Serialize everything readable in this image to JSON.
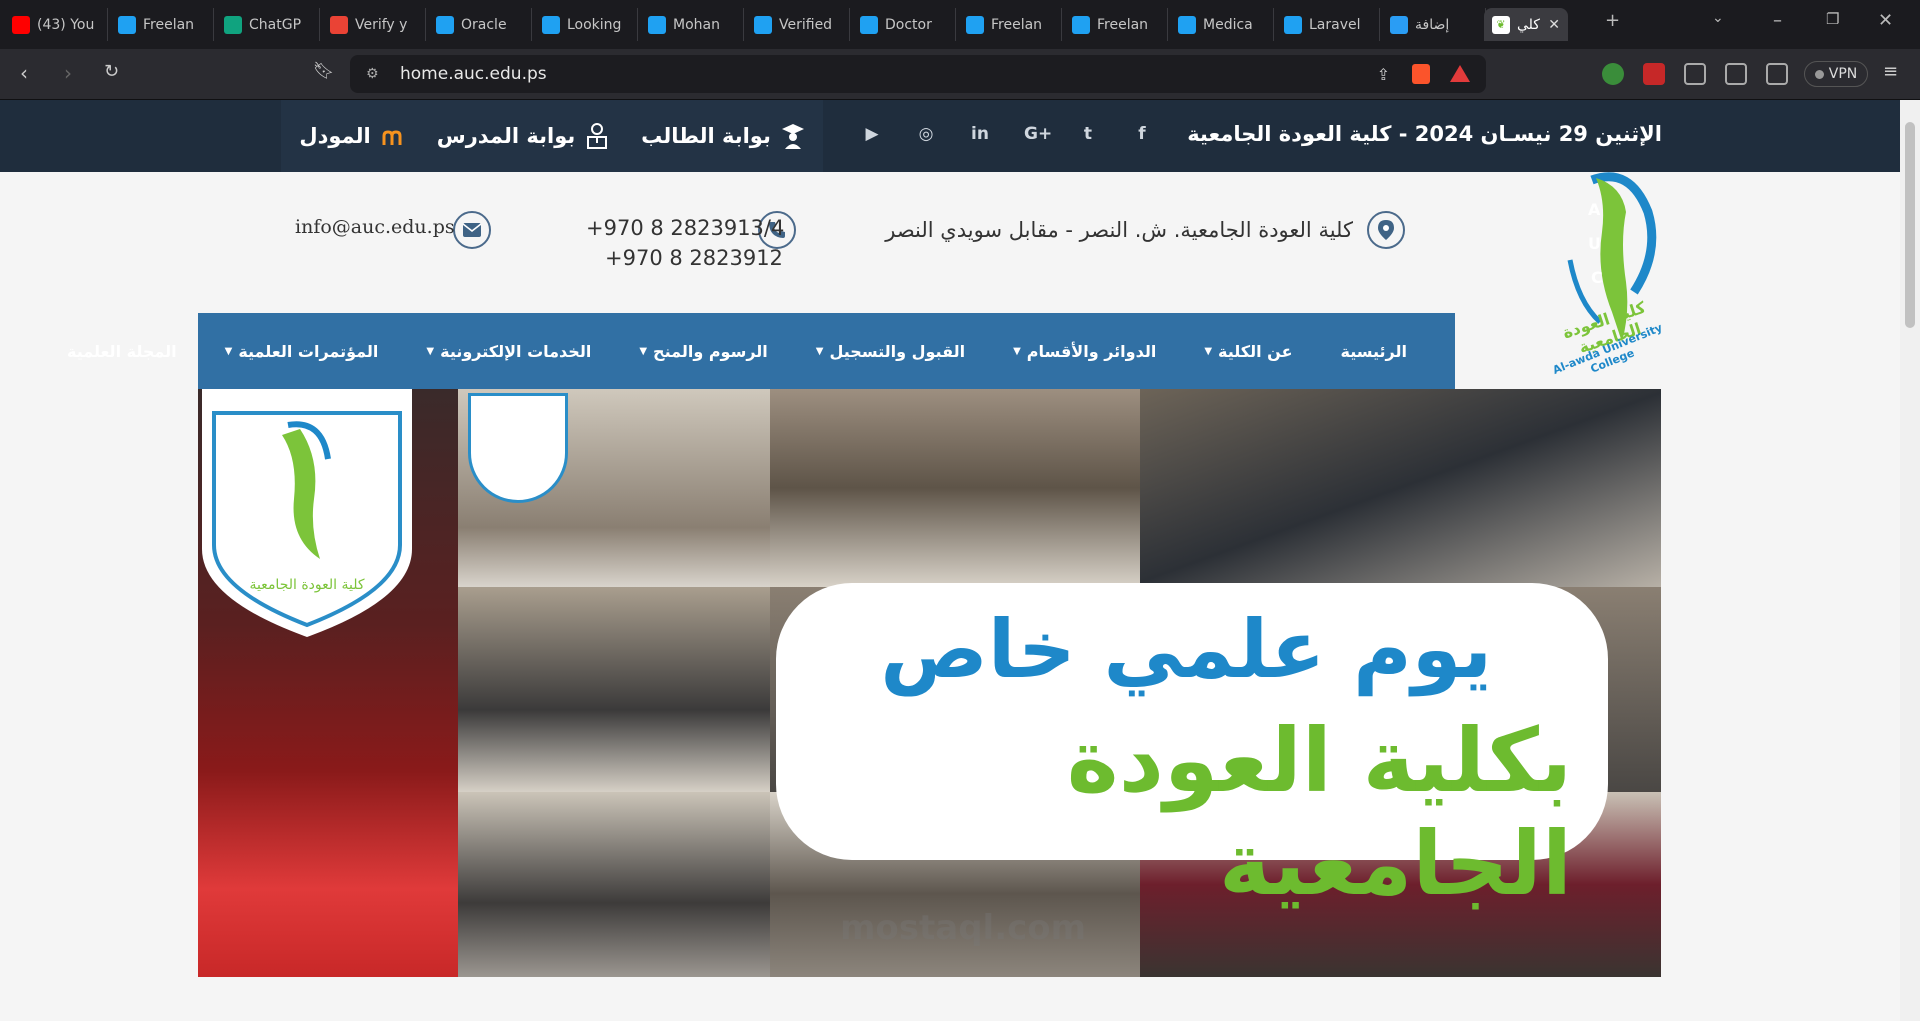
{
  "browser": {
    "tabs": [
      {
        "label": "(43) You",
        "favicon": "youtube-icon",
        "color": "#ff0000"
      },
      {
        "label": "Freelan",
        "favicon": "bird-icon",
        "color": "#1fa1f2"
      },
      {
        "label": "ChatGP",
        "favicon": "chatgpt-icon",
        "color": "#10a37f"
      },
      {
        "label": "Verify y",
        "favicon": "gmail-icon",
        "color": "#ea4335"
      },
      {
        "label": "Oracle",
        "favicon": "bird-icon",
        "color": "#1fa1f2"
      },
      {
        "label": "Looking",
        "favicon": "bird-icon",
        "color": "#1fa1f2"
      },
      {
        "label": "Mohan",
        "favicon": "bird-icon",
        "color": "#1fa1f2"
      },
      {
        "label": "Verified",
        "favicon": "bird-icon",
        "color": "#1fa1f2"
      },
      {
        "label": "Doctor",
        "favicon": "bird-icon",
        "color": "#1fa1f2"
      },
      {
        "label": "Freelan",
        "favicon": "bird-icon",
        "color": "#1fa1f2"
      },
      {
        "label": "Freelan",
        "favicon": "bird-icon",
        "color": "#1fa1f2"
      },
      {
        "label": "Medica",
        "favicon": "bird-icon",
        "color": "#1fa1f2"
      },
      {
        "label": "Laravel",
        "favicon": "bird-icon",
        "color": "#1fa1f2"
      },
      {
        "label": "إضافة",
        "favicon": "circle-icon",
        "color": "#2a9df4"
      }
    ],
    "active_tab": {
      "label": "كلي",
      "favicon": "leaf-icon"
    },
    "url": "home.auc.edu.ps",
    "vpn_label": "VPN"
  },
  "site": {
    "topbar": {
      "date_line": "الإثنين 29 نيسـان 2024 - كلية العودة الجامعية",
      "socials": [
        "facebook-icon",
        "twitter-icon",
        "google-plus-icon",
        "linkedin-icon",
        "instagram-icon",
        "youtube-icon"
      ],
      "social_glyphs": [
        "f",
        "t",
        "G+",
        "in",
        "◎",
        "▶"
      ],
      "student_portal": "بوابة الطالب",
      "teacher_portal": "بوابة المدرس",
      "moodle": "المودل"
    },
    "contact": {
      "address": "كلية العودة الجامعية. ش. النصر - مقابل سويدي النصر",
      "phone_1": "+970 8 2823913/4",
      "phone_2": "+970 8 2823912",
      "email": "info@auc.edu.ps"
    },
    "logo": {
      "letters": [
        "A",
        "U",
        "C"
      ],
      "arabic_name": "كلية العودة الجامعية",
      "english_name": "Al-awda University College"
    },
    "nav": [
      {
        "label": "الرئيسية",
        "dropdown": false
      },
      {
        "label": "عن الكلية",
        "dropdown": true
      },
      {
        "label": "الدوائر والأقسام",
        "dropdown": true
      },
      {
        "label": "القبول والتسجيل",
        "dropdown": true
      },
      {
        "label": "الرسوم والمنح",
        "dropdown": true
      },
      {
        "label": "الخدمات الإلكترونية",
        "dropdown": true
      },
      {
        "label": "المؤتمرات العلمية",
        "dropdown": true
      },
      {
        "label": "المجلة العلمية",
        "dropdown": false
      }
    ],
    "banner": {
      "headline_line1": "يوم علمي خاص",
      "headline_line2": "بكلية العودة الجامعية"
    },
    "watermark": "mostaql.com"
  },
  "colors": {
    "topbar": "#1f2d3d",
    "nav": "#3170a4",
    "headline_blue": "#1e88c9",
    "headline_green": "#6dbb2f"
  }
}
